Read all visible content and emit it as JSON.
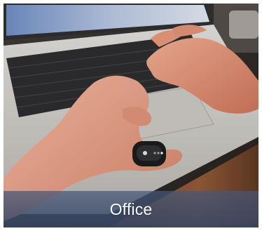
{
  "card": {
    "caption": "Office",
    "caption_bar_color": "#4a5d82"
  },
  "photo": {
    "laptop_color": "#c9c7c3",
    "keyboard_color": "#2a2a2d",
    "skin_color": "#d9967e",
    "wood_color": "#7a4a2c",
    "device_color": "#1a1a1c"
  }
}
